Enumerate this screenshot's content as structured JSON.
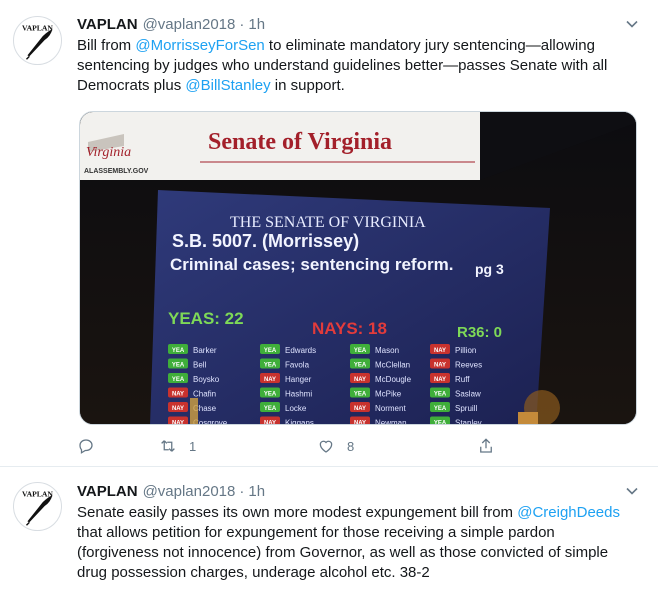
{
  "tweets": [
    {
      "name": "VAPLAN",
      "handle": "@vaplan2018",
      "dot": "·",
      "time": "1h",
      "avatar_text": "VAPLAN",
      "text_parts": [
        "Bill from ",
        "@MorrisseyForSen",
        " to eliminate mandatory jury sentencing—allowing sentencing by judges who understand guidelines better—passes Senate with all Democrats plus ",
        "@BillStanley",
        " in support."
      ],
      "image": {
        "banner_title": "Senate of Virginia",
        "banner_logo": "Virginia",
        "banner_site": "ALASSEMBLY.GOV",
        "screen_heading": "THE SENATE OF VIRGINIA",
        "bill_number": "S.B. 5007. (Morrissey)",
        "bill_title": "Criminal cases; sentencing reform.",
        "page": "pg 3",
        "yeas": "YEAS: 22",
        "nays": "NAYS: 18",
        "rule": "R36: 0",
        "col1": [
          [
            "YEA",
            "Barker"
          ],
          [
            "YEA",
            "Bell"
          ],
          [
            "YEA",
            "Boysko"
          ],
          [
            "NAY",
            "Chafin"
          ],
          [
            "NAY",
            "Chase"
          ],
          [
            "NAY",
            "Cosgrove"
          ]
        ],
        "col2": [
          [
            "YEA",
            "Edwards"
          ],
          [
            "YEA",
            "Favola"
          ],
          [
            "NAY",
            "Hanger"
          ],
          [
            "YEA",
            "Hashmi"
          ],
          [
            "YEA",
            "Locke"
          ],
          [
            "NAY",
            "Kiggans"
          ]
        ],
        "col3": [
          [
            "YEA",
            "Mason"
          ],
          [
            "YEA",
            "McClellan"
          ],
          [
            "NAY",
            "McDougle"
          ],
          [
            "YEA",
            "McPike"
          ],
          [
            "NAY",
            "Norment"
          ],
          [
            "NAY",
            "Newman"
          ]
        ],
        "col4": [
          [
            "NAY",
            "Pillion"
          ],
          [
            "NAY",
            "Reeves"
          ],
          [
            "NAY",
            "Ruff"
          ],
          [
            "YEA",
            "Saslaw"
          ],
          [
            "YEA",
            "Spruill"
          ],
          [
            "YEA",
            "Stanley"
          ]
        ]
      },
      "retweets": "1",
      "likes": "8"
    },
    {
      "name": "VAPLAN",
      "handle": "@vaplan2018",
      "dot": "·",
      "time": "1h",
      "avatar_text": "VAPLAN",
      "text_parts": [
        "Senate easily passes its own more modest expungement bill from ",
        "@CreighDeeds",
        " that allows petition for expungement for those receiving a simple pardon (forgiveness not innocence) from Governor, as well as those convicted of simple drug possession charges, underage alcohol etc. 38-2"
      ]
    }
  ],
  "colors": {
    "link": "#1da1f2",
    "muted": "#657786",
    "text": "#14171a",
    "border": "#e6ecf0"
  }
}
